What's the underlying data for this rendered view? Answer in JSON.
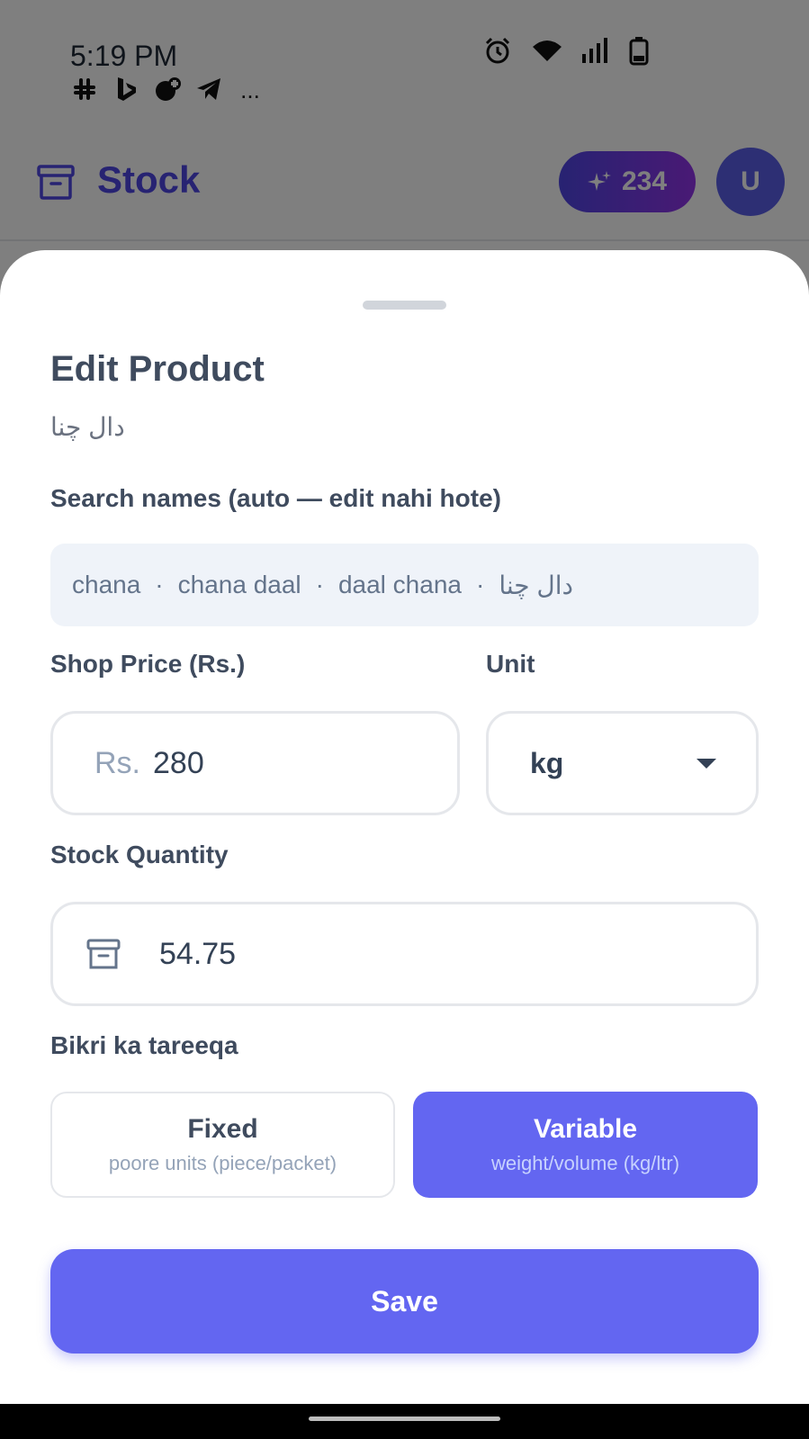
{
  "status_bar": {
    "time": "5:19 PM",
    "more_notifications": "...",
    "notification_icons": [
      "slack-icon",
      "bing-icon",
      "chat-plus-icon",
      "telegram-icon"
    ],
    "system_icons": [
      "alarm-icon",
      "wifi-icon",
      "signal-icon",
      "battery-icon"
    ]
  },
  "app_header": {
    "title": "Stock",
    "icon": "archive-box-icon",
    "credits": "234",
    "credits_icon": "sparkles-icon",
    "avatar_initial": "U",
    "accent_color": "#4f46e5"
  },
  "sheet": {
    "title": "Edit Product",
    "subtitle": "دال چنا",
    "search_names": {
      "label": "Search names (auto — edit nahi hote)",
      "items": [
        "chana",
        "chana daal",
        "daal chana",
        "دال چنا"
      ],
      "separator": "·"
    },
    "price": {
      "label": "Shop Price (Rs.)",
      "prefix": "Rs.",
      "value": "280"
    },
    "unit": {
      "label": "Unit",
      "value": "kg"
    },
    "stock": {
      "label": "Stock Quantity",
      "value": "54.75",
      "icon": "archive-box-icon"
    },
    "sale_method": {
      "label": "Bikri ka tareeqa",
      "options": [
        {
          "title": "Fixed",
          "subtitle": "poore units (piece/packet)",
          "selected": false
        },
        {
          "title": "Variable",
          "subtitle": "weight/volume (kg/ltr)",
          "selected": true
        }
      ],
      "selected_color": "#6366f1"
    },
    "save_label": "Save"
  }
}
